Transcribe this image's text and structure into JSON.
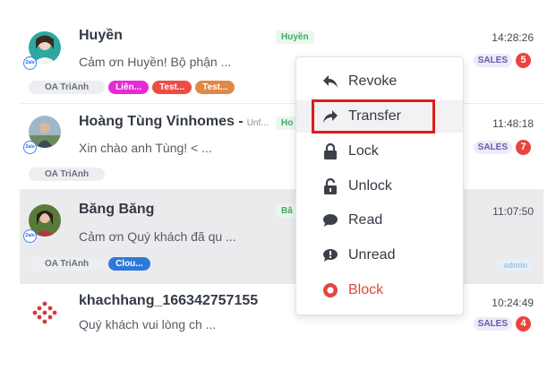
{
  "conversations": [
    {
      "name": "Huyền",
      "name_suffix": "",
      "agent": "Huyền",
      "preview": "Cảm ơn Huyền! Bộ phận ...",
      "time": "14:28:26",
      "department": "SALES",
      "unread_count": "5",
      "oa": "OA TriAnh",
      "tags": [
        "Liên...",
        "Test...",
        "Test..."
      ]
    },
    {
      "name": "Hoàng Tùng Vinhomes -",
      "name_suffix": "Unf...",
      "agent": "Ho",
      "preview": "Xin chào anh Tùng! < ...",
      "time": "11:48:18",
      "department": "SALES",
      "unread_count": "7",
      "oa": "OA TriAnh",
      "tags": []
    },
    {
      "name": "Băng Băng",
      "name_suffix": "",
      "agent": "Bă",
      "preview": "Cảm ơn Quý khách đã qu ...",
      "time": "11:07:50",
      "department": "",
      "unread_count": "",
      "oa": "OA TriAnh",
      "tags": [
        "Clou..."
      ],
      "assignee": "admin"
    },
    {
      "name": "khachhang_166342757155",
      "name_suffix": "",
      "agent": "",
      "preview": "Quý khách vui lòng ch ...",
      "time": "10:24:49",
      "department": "SALES",
      "unread_count": "4",
      "oa": "",
      "tags": []
    }
  ],
  "context_menu": {
    "items": [
      {
        "label": "Revoke",
        "icon": "reply-arrow-icon"
      },
      {
        "label": "Transfer",
        "icon": "share-arrow-icon"
      },
      {
        "label": "Lock",
        "icon": "lock-icon"
      },
      {
        "label": "Unlock",
        "icon": "unlock-icon"
      },
      {
        "label": "Read",
        "icon": "chat-bubble-icon"
      },
      {
        "label": "Unread",
        "icon": "chat-alert-icon"
      },
      {
        "label": "Block",
        "icon": "block-circle-icon"
      }
    ]
  },
  "colors": {
    "badge_red": "#e8453c",
    "highlight_border": "#e01b1b",
    "block_red": "#e1473f",
    "agent_green": "#44a96a",
    "tag_magenta": "#e62ad6",
    "tag_red": "#ee4b45",
    "tag_orange": "#e08847",
    "tag_blue": "#2f78d8"
  }
}
